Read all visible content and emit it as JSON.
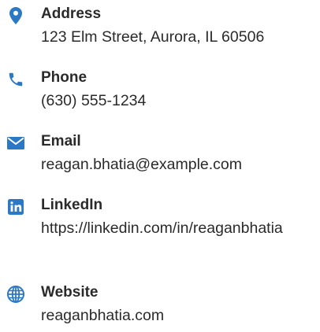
{
  "theme": {
    "accent": "#2b78c5",
    "text": "#2a2a2a"
  },
  "contacts": [
    {
      "icon": "map-pin-icon",
      "label": "Address",
      "value": "123 Elm Street, Aurora, IL 60506"
    },
    {
      "icon": "phone-icon",
      "label": "Phone",
      "value": "(630) 555-1234"
    },
    {
      "icon": "envelope-icon",
      "label": "Email",
      "value": "reagan.bhatia@example.com"
    },
    {
      "icon": "linkedin-icon",
      "label": "LinkedIn",
      "value": "https://linkedin.com/in/reaganbhatia"
    },
    {
      "icon": "globe-icon",
      "label": "Website",
      "value": "reaganbhatia.com"
    }
  ]
}
